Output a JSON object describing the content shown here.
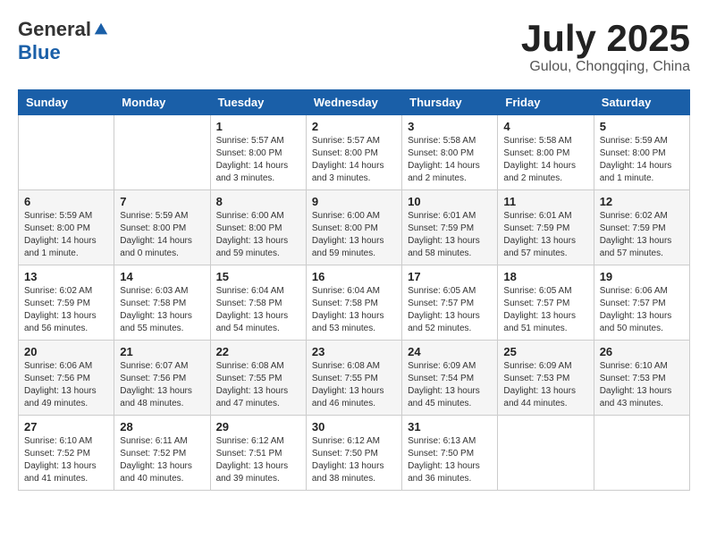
{
  "logo": {
    "general": "General",
    "blue": "Blue"
  },
  "title": {
    "month": "July 2025",
    "location": "Gulou, Chongqing, China"
  },
  "weekdays": [
    "Sunday",
    "Monday",
    "Tuesday",
    "Wednesday",
    "Thursday",
    "Friday",
    "Saturday"
  ],
  "weeks": [
    [
      {
        "day": "",
        "info": ""
      },
      {
        "day": "",
        "info": ""
      },
      {
        "day": "1",
        "info": "Sunrise: 5:57 AM\nSunset: 8:00 PM\nDaylight: 14 hours\nand 3 minutes."
      },
      {
        "day": "2",
        "info": "Sunrise: 5:57 AM\nSunset: 8:00 PM\nDaylight: 14 hours\nand 3 minutes."
      },
      {
        "day": "3",
        "info": "Sunrise: 5:58 AM\nSunset: 8:00 PM\nDaylight: 14 hours\nand 2 minutes."
      },
      {
        "day": "4",
        "info": "Sunrise: 5:58 AM\nSunset: 8:00 PM\nDaylight: 14 hours\nand 2 minutes."
      },
      {
        "day": "5",
        "info": "Sunrise: 5:59 AM\nSunset: 8:00 PM\nDaylight: 14 hours\nand 1 minute."
      }
    ],
    [
      {
        "day": "6",
        "info": "Sunrise: 5:59 AM\nSunset: 8:00 PM\nDaylight: 14 hours\nand 1 minute."
      },
      {
        "day": "7",
        "info": "Sunrise: 5:59 AM\nSunset: 8:00 PM\nDaylight: 14 hours\nand 0 minutes."
      },
      {
        "day": "8",
        "info": "Sunrise: 6:00 AM\nSunset: 8:00 PM\nDaylight: 13 hours\nand 59 minutes."
      },
      {
        "day": "9",
        "info": "Sunrise: 6:00 AM\nSunset: 8:00 PM\nDaylight: 13 hours\nand 59 minutes."
      },
      {
        "day": "10",
        "info": "Sunrise: 6:01 AM\nSunset: 7:59 PM\nDaylight: 13 hours\nand 58 minutes."
      },
      {
        "day": "11",
        "info": "Sunrise: 6:01 AM\nSunset: 7:59 PM\nDaylight: 13 hours\nand 57 minutes."
      },
      {
        "day": "12",
        "info": "Sunrise: 6:02 AM\nSunset: 7:59 PM\nDaylight: 13 hours\nand 57 minutes."
      }
    ],
    [
      {
        "day": "13",
        "info": "Sunrise: 6:02 AM\nSunset: 7:59 PM\nDaylight: 13 hours\nand 56 minutes."
      },
      {
        "day": "14",
        "info": "Sunrise: 6:03 AM\nSunset: 7:58 PM\nDaylight: 13 hours\nand 55 minutes."
      },
      {
        "day": "15",
        "info": "Sunrise: 6:04 AM\nSunset: 7:58 PM\nDaylight: 13 hours\nand 54 minutes."
      },
      {
        "day": "16",
        "info": "Sunrise: 6:04 AM\nSunset: 7:58 PM\nDaylight: 13 hours\nand 53 minutes."
      },
      {
        "day": "17",
        "info": "Sunrise: 6:05 AM\nSunset: 7:57 PM\nDaylight: 13 hours\nand 52 minutes."
      },
      {
        "day": "18",
        "info": "Sunrise: 6:05 AM\nSunset: 7:57 PM\nDaylight: 13 hours\nand 51 minutes."
      },
      {
        "day": "19",
        "info": "Sunrise: 6:06 AM\nSunset: 7:57 PM\nDaylight: 13 hours\nand 50 minutes."
      }
    ],
    [
      {
        "day": "20",
        "info": "Sunrise: 6:06 AM\nSunset: 7:56 PM\nDaylight: 13 hours\nand 49 minutes."
      },
      {
        "day": "21",
        "info": "Sunrise: 6:07 AM\nSunset: 7:56 PM\nDaylight: 13 hours\nand 48 minutes."
      },
      {
        "day": "22",
        "info": "Sunrise: 6:08 AM\nSunset: 7:55 PM\nDaylight: 13 hours\nand 47 minutes."
      },
      {
        "day": "23",
        "info": "Sunrise: 6:08 AM\nSunset: 7:55 PM\nDaylight: 13 hours\nand 46 minutes."
      },
      {
        "day": "24",
        "info": "Sunrise: 6:09 AM\nSunset: 7:54 PM\nDaylight: 13 hours\nand 45 minutes."
      },
      {
        "day": "25",
        "info": "Sunrise: 6:09 AM\nSunset: 7:53 PM\nDaylight: 13 hours\nand 44 minutes."
      },
      {
        "day": "26",
        "info": "Sunrise: 6:10 AM\nSunset: 7:53 PM\nDaylight: 13 hours\nand 43 minutes."
      }
    ],
    [
      {
        "day": "27",
        "info": "Sunrise: 6:10 AM\nSunset: 7:52 PM\nDaylight: 13 hours\nand 41 minutes."
      },
      {
        "day": "28",
        "info": "Sunrise: 6:11 AM\nSunset: 7:52 PM\nDaylight: 13 hours\nand 40 minutes."
      },
      {
        "day": "29",
        "info": "Sunrise: 6:12 AM\nSunset: 7:51 PM\nDaylight: 13 hours\nand 39 minutes."
      },
      {
        "day": "30",
        "info": "Sunrise: 6:12 AM\nSunset: 7:50 PM\nDaylight: 13 hours\nand 38 minutes."
      },
      {
        "day": "31",
        "info": "Sunrise: 6:13 AM\nSunset: 7:50 PM\nDaylight: 13 hours\nand 36 minutes."
      },
      {
        "day": "",
        "info": ""
      },
      {
        "day": "",
        "info": ""
      }
    ]
  ]
}
